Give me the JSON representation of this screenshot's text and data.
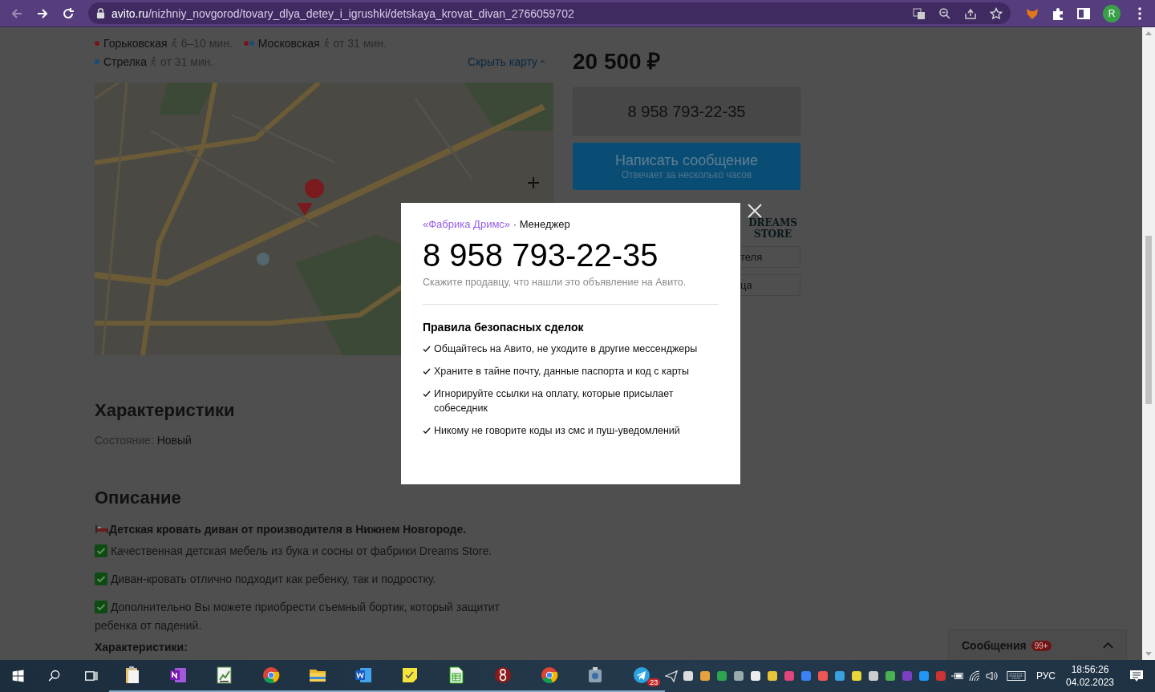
{
  "browser": {
    "url_host": "avito.ru",
    "url_path": "/nizhniy_novgorod/tovary_dlya_detey_i_igrushki/detskaya_krovat_divan_2766059702",
    "avatar": "R"
  },
  "metro": [
    {
      "name": "Горьковская",
      "dots": [
        {
          "color": "#7a1418"
        }
      ],
      "time": "6–10 мин."
    },
    {
      "name": "Московская",
      "dots": [
        {
          "color": "#7a1418"
        },
        {
          "color": "#1b4a75"
        }
      ],
      "time": "от 31 мин."
    },
    {
      "name": "Стрелка",
      "dots": [
        {
          "color": "#1b4a75"
        }
      ],
      "time": "от 31 мин."
    }
  ],
  "hide_map": "Скрыть карту",
  "price": "20 500 ₽",
  "phone_button": "8 958 793-22-35",
  "message_button": {
    "title": "Написать сообщение",
    "subtitle": "Отвечает за несколько часов"
  },
  "seller_logo": [
    "DREAMS",
    "STORE"
  ],
  "side_buttons": [
    "теля",
    "ца"
  ],
  "characteristics": {
    "heading": "Характеристики",
    "label": "Состояние:",
    "value": "Новый"
  },
  "description": {
    "heading": "Описание",
    "lead": "Детская кровать диван от производителя в Нижнем Новгороде.",
    "points": [
      "Качественная детская мебель из бука и сосны от фабрики Dreams Store.",
      "Диван-кровать отлично подходит как ребенку, так и подростку.",
      "Дополнительно Вы можете приобрести съемный бортик, который защитит ребенка от падений."
    ],
    "subheading": "Характеристики:"
  },
  "modal": {
    "seller": "«Фабрика Дримс»",
    "role": "· Менеджер",
    "phone": "8 958 793-22-35",
    "hint": "Скажите продавцу, что нашли это объявление на Авито.",
    "rules_title": "Правила безопасных сделок",
    "rules": [
      "Общайтесь на Авито, не уходите в другие мессенджеры",
      "Храните в тайне почту, данные паспорта и код с карты",
      "Игнорируйте ссылки на оплату, которые присылает собеседник",
      "Никому не говорите коды из смс и пуш-уведомлений"
    ]
  },
  "messages_widget": {
    "title": "Сообщения",
    "badge": "99+"
  },
  "taskbar": {
    "apps": [
      {
        "kind": "clipboard",
        "running": true
      },
      {
        "kind": "onenote",
        "running": true
      },
      {
        "kind": "sheet",
        "running": true
      },
      {
        "kind": "chrome",
        "running": true
      },
      {
        "kind": "folder",
        "running": true
      },
      {
        "kind": "word",
        "running": true
      },
      {
        "kind": "sticky",
        "running": true
      },
      {
        "kind": "calc",
        "running": true
      },
      {
        "kind": "red",
        "running": true
      },
      {
        "kind": "chrome",
        "running": true
      },
      {
        "kind": "tool",
        "running": true
      },
      {
        "kind": "telegram",
        "running": true,
        "badge": "23"
      }
    ],
    "language": "РУС",
    "time": "18:56:26",
    "date": "04.02.2023"
  }
}
